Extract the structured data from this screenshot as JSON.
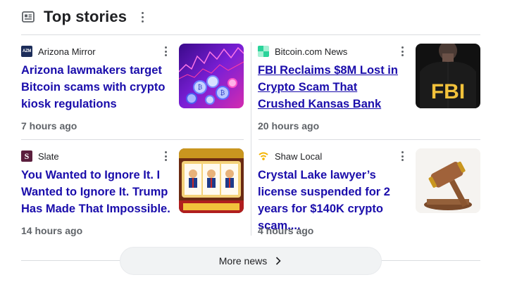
{
  "section": {
    "title": "Top stories",
    "icon": "newspaper-icon"
  },
  "stories": [
    {
      "source": "Arizona Mirror",
      "source_logo_text": "AZM",
      "source_logo_color": "#1c2d5a",
      "headline": "Arizona lawmakers target Bitcoin scams with crypto kiosk regulations",
      "time": "7 hours ago",
      "thumbnail": "bitcoin-coins-neon-image"
    },
    {
      "source": "Bitcoin.com News",
      "source_logo_color": "#2ad39a",
      "headline": "FBI Reclaims $8M Lost in Crypto Scam That Crushed Kansas Bank",
      "time": "20 hours ago",
      "thumbnail": "fbi-agent-jacket-image"
    },
    {
      "source": "Slate",
      "source_logo_text": "S",
      "source_logo_color": "#5b1f3e",
      "headline": "You Wanted to Ignore It. I Wanted to Ignore It. Trump Has Made That Impossible.",
      "time": "14 hours ago",
      "thumbnail": "slot-machine-jackpot-image"
    },
    {
      "source": "Shaw Local",
      "source_logo_color": "#f4b400",
      "headline": "Crystal Lake lawyer’s license suspended for 2 years for $140K crypto scam,...",
      "time": "4 hours ago",
      "thumbnail": "judge-gavel-image"
    }
  ],
  "more_news": {
    "label": "More news",
    "icon": "chevron-right-icon"
  },
  "colors": {
    "headline_link": "#1a0dab",
    "secondary_text": "#5f6368",
    "divider": "#dadce0",
    "button_bg": "#f1f3f4"
  }
}
